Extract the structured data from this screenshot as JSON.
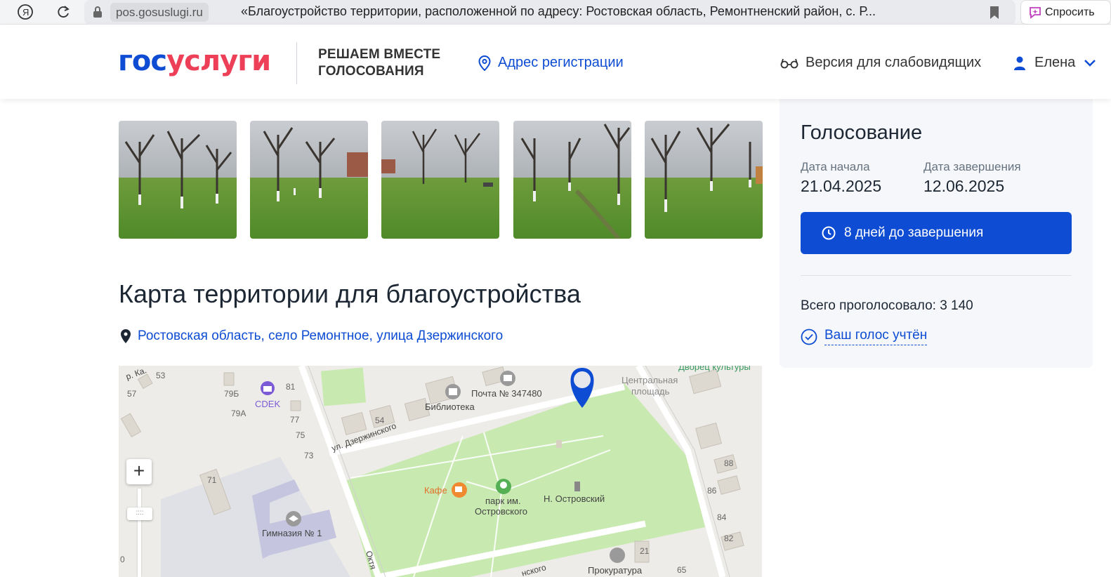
{
  "browser": {
    "domain": "pos.gosuslugi.ru",
    "tab_title": "«Благоустройство территории, расположенной по адресу: Ростовская область, Ремонтненский район, с. Р...",
    "ask_label": "Спросить",
    "icons": [
      "yandex-icon",
      "reload-icon",
      "lock-icon",
      "bookmark-icon",
      "alice-icon"
    ]
  },
  "header": {
    "logo_part1": "гос",
    "logo_part2": "услуги",
    "project_line1": "РЕШАЕМ ВМЕСТЕ",
    "project_line2": "ГОЛОСОВАНИЯ",
    "reg_address": "Адрес регистрации",
    "vision_version": "Версия для слабовидящих",
    "user_name": "Елена"
  },
  "photos": [
    {
      "label": "photo-1"
    },
    {
      "label": "photo-2"
    },
    {
      "label": "photo-3"
    },
    {
      "label": "photo-4"
    },
    {
      "label": "photo-5"
    }
  ],
  "map": {
    "title": "Карта территории для благоустройства",
    "address": "Ростовская область, село Ремонтное, улица Дзержинского",
    "labels": {
      "post": "Почта № 347480",
      "library": "Библиотека",
      "street": "ул. Дзержинского",
      "central_square_1": "Центральная",
      "central_square_2": "площадь",
      "culture_palace": "Дворец культуры",
      "cafe": "Кафе",
      "park_1": "парк им.",
      "park_2": "Островского",
      "monument": "Н. Островский",
      "gymnasium": "Гимназия № 1",
      "cdek": "CDEK",
      "prosecutor": "Прокуратура",
      "oct": "Октя",
      "street_bottom": "нского",
      "n53": "53",
      "n57": "57",
      "n79b": "79Б",
      "n81": "81",
      "n79a": "79А",
      "n77": "77",
      "n75": "75",
      "n73": "73",
      "n71": "71",
      "n54": "54",
      "n88": "88",
      "n86": "86",
      "n84": "84",
      "n82": "82",
      "n21": "21",
      "n65": "65",
      "n0": "0"
    }
  },
  "voting": {
    "title": "Голосование",
    "start_label": "Дата начала",
    "start_date": "21.04.2025",
    "end_label": "Дата завершения",
    "end_date": "12.06.2025",
    "days_left": "8 дней до завершения",
    "total_votes": "Всего проголосовало: 3 140",
    "vote_counted": "Ваш голос учтён"
  },
  "colors": {
    "brand_blue": "#0d4cd3",
    "brand_red": "#ee3f58",
    "park_green": "#c8eab0"
  }
}
